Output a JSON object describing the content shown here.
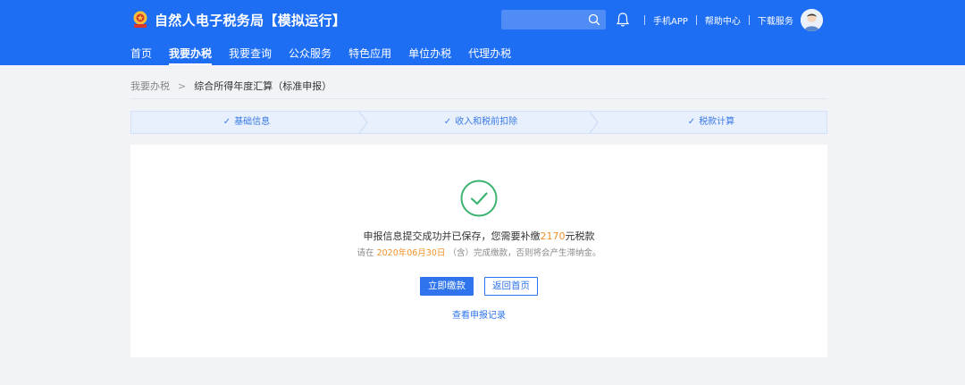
{
  "header": {
    "site_title": "自然人电子税务局【模拟运行】",
    "search": {
      "placeholder": ""
    },
    "links": [
      "手机APP",
      "帮助中心",
      "下载服务"
    ]
  },
  "nav": {
    "items": [
      {
        "label": "首页",
        "active": false
      },
      {
        "label": "我要办税",
        "active": true
      },
      {
        "label": "我要查询",
        "active": false
      },
      {
        "label": "公众服务",
        "active": false
      },
      {
        "label": "特色应用",
        "active": false
      },
      {
        "label": "单位办税",
        "active": false
      },
      {
        "label": "代理办税",
        "active": false
      }
    ]
  },
  "breadcrumb": {
    "parent": "我要办税",
    "separator": ">",
    "current": "综合所得年度汇算（标准申报）"
  },
  "steps": [
    {
      "label": "基础信息",
      "done": true
    },
    {
      "label": "收入和税前扣除",
      "done": true
    },
    {
      "label": "税款计算",
      "done": true
    }
  ],
  "result": {
    "line1_prefix": "申报信息提交成功并已保存，您需要补缴",
    "amount": "2170",
    "line1_suffix": "元税款",
    "line2_prefix": "请在",
    "deadline": "2020年06月30日",
    "line2_suffix": "（含）完成缴款，否则将会产生滞纳金。",
    "pay_button": "立即缴款",
    "home_button": "返回首页",
    "records_link": "查看申报记录"
  },
  "colors": {
    "header_bg": "#1e6ef4",
    "accent": "#2f74ec",
    "highlight": "#f0932b",
    "success": "#3cb371"
  },
  "icons": [
    "emblem-icon",
    "search-icon",
    "bell-icon",
    "avatar",
    "check-icon",
    "success-check-icon"
  ]
}
